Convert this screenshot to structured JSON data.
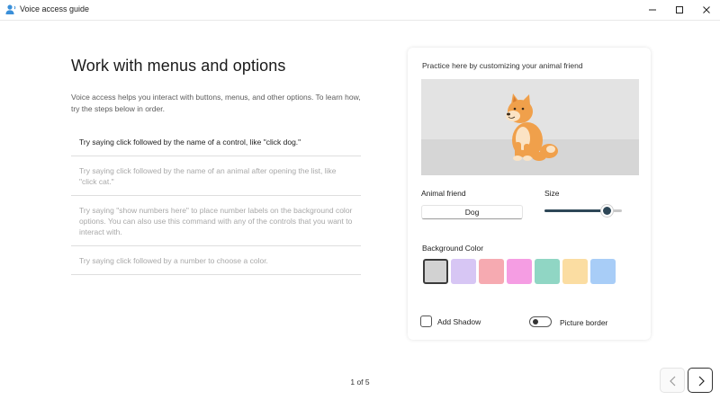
{
  "window": {
    "title": "Voice access guide",
    "icons": {
      "app": "voice-access-person-icon",
      "minimize": "minimize-icon",
      "maximize": "maximize-icon",
      "close": "close-icon"
    }
  },
  "main": {
    "heading": "Work with menus and options",
    "intro": "Voice access helps you interact with buttons, menus, and other options. To learn how, try the steps below in order.",
    "steps": [
      {
        "text": "Try saying click followed by the name of a control, like \"click dog.\"",
        "active": true
      },
      {
        "text": "Try saying click followed by the name of an animal after opening the list, like \"click cat.\"",
        "active": false
      },
      {
        "text": "Try saying \"show numbers here\" to place number labels on the background color options. You can also use this command with any of the controls that you want to interact with.",
        "active": false
      },
      {
        "text": "Try saying click followed by a number to choose a color.",
        "active": false
      }
    ]
  },
  "practice": {
    "title": "Practice here by customizing your animal friend",
    "animal_label": "Animal friend",
    "animal_value": "Dog",
    "size_label": "Size",
    "size_level": 0.8,
    "background_label": "Background Color",
    "colors": [
      "#d2d2d2",
      "#d7c6f4",
      "#f6aab1",
      "#f59de3",
      "#90d6c4",
      "#fbdda2",
      "#a8cdf7"
    ],
    "selected_color_index": 0,
    "shadow_label": "Add Shadow",
    "shadow_checked": false,
    "border_label": "Picture border",
    "border_on": false,
    "scene_colors": {
      "background": "#e3e3e3",
      "floor": "#d6d6d6",
      "dog": "#f0a04b"
    }
  },
  "footer": {
    "page_indicator": "1 of 5",
    "prev_icon": "chevron-left-icon",
    "next_icon": "chevron-right-icon"
  }
}
